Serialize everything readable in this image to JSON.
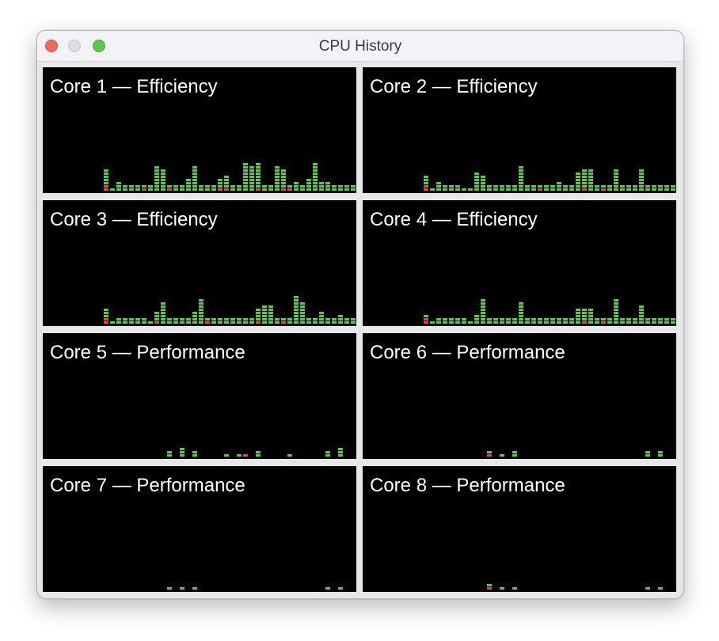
{
  "window": {
    "title": "CPU History",
    "buttons": [
      "close",
      "minimize",
      "zoom"
    ]
  },
  "colors": {
    "background": "#000000",
    "system": "#e8483c",
    "user": "#5cc94a",
    "traffic_close": "#ec6a5e",
    "traffic_min": "#dddde1",
    "traffic_zoom": "#61c554"
  },
  "cores": [
    {
      "label": "Core 1 — Efficiency",
      "system": [
        2,
        0,
        0,
        0,
        0,
        0,
        1,
        0,
        0,
        0,
        1,
        0,
        0,
        0,
        0,
        0,
        0,
        0,
        1,
        1,
        0,
        0,
        0,
        0,
        1,
        0,
        0,
        0,
        1,
        1,
        0,
        0,
        0,
        0,
        0,
        0,
        0,
        0
      ],
      "total": [
        7,
        1,
        3,
        2,
        2,
        2,
        2,
        2,
        8,
        7,
        2,
        2,
        2,
        4,
        8,
        2,
        2,
        2,
        4,
        5,
        2,
        2,
        9,
        8,
        9,
        2,
        2,
        8,
        7,
        2,
        3,
        2,
        4,
        9,
        3,
        3,
        2,
        2,
        2,
        2
      ]
    },
    {
      "label": "Core 2 — Efficiency",
      "system": [
        2,
        0,
        0,
        0,
        0,
        0,
        0,
        0,
        0,
        0,
        0,
        0,
        0,
        0,
        0,
        0,
        0,
        0,
        1,
        0,
        0,
        0,
        0,
        0,
        0,
        1,
        0,
        0,
        1,
        0,
        0,
        0,
        0,
        0,
        0,
        0,
        0,
        0
      ],
      "total": [
        5,
        1,
        3,
        2,
        2,
        2,
        1,
        1,
        6,
        5,
        2,
        2,
        2,
        2,
        2,
        8,
        2,
        2,
        2,
        2,
        2,
        3,
        2,
        2,
        6,
        7,
        7,
        2,
        2,
        2,
        7,
        2,
        2,
        2,
        7,
        2,
        2,
        2,
        2,
        2
      ]
    },
    {
      "label": "Core 3 — Efficiency",
      "system": [
        2,
        0,
        0,
        0,
        0,
        0,
        0,
        0,
        1,
        0,
        0,
        0,
        0,
        0,
        0,
        0,
        1,
        0,
        0,
        0,
        0,
        0,
        0,
        0,
        1,
        0,
        0,
        0,
        1,
        0,
        0,
        0,
        0,
        0,
        0,
        0,
        0,
        0
      ],
      "total": [
        5,
        1,
        2,
        2,
        2,
        2,
        2,
        1,
        4,
        7,
        2,
        2,
        2,
        2,
        4,
        8,
        2,
        2,
        2,
        2,
        2,
        2,
        2,
        2,
        5,
        6,
        6,
        2,
        2,
        2,
        9,
        7,
        2,
        2,
        4,
        2,
        2,
        3,
        2,
        2
      ]
    },
    {
      "label": "Core 4 — Efficiency",
      "system": [
        2,
        0,
        0,
        0,
        0,
        0,
        0,
        0,
        0,
        0,
        0,
        0,
        0,
        0,
        0,
        0,
        0,
        0,
        0,
        0,
        0,
        0,
        0,
        0,
        0,
        1,
        0,
        0,
        1,
        0,
        0,
        0,
        0,
        0,
        0,
        0,
        0,
        0
      ],
      "total": [
        3,
        1,
        2,
        2,
        2,
        2,
        2,
        1,
        3,
        8,
        2,
        2,
        2,
        2,
        2,
        7,
        2,
        2,
        2,
        2,
        2,
        2,
        2,
        2,
        5,
        5,
        5,
        2,
        2,
        2,
        8,
        2,
        2,
        2,
        6,
        2,
        2,
        2,
        2,
        2
      ]
    },
    {
      "label": "Core 5 — Performance",
      "system": [
        0,
        0,
        0,
        0,
        0,
        0,
        0,
        0,
        0,
        0,
        0,
        0,
        1,
        0,
        0,
        0,
        0,
        0,
        0,
        0,
        0,
        0,
        0,
        0,
        0,
        0,
        0,
        0,
        0,
        0
      ],
      "total": [
        2,
        0,
        3,
        0,
        2,
        0,
        0,
        0,
        0,
        1,
        0,
        1,
        1,
        0,
        2,
        0,
        0,
        0,
        0,
        1,
        0,
        0,
        0,
        0,
        0,
        2,
        0,
        3,
        0,
        0
      ]
    },
    {
      "label": "Core 6 — Performance",
      "system": [
        1,
        0,
        0,
        0,
        0,
        0,
        0,
        0,
        0,
        0,
        0,
        0,
        0,
        0,
        0,
        0,
        0,
        0,
        0,
        0,
        0,
        0,
        0,
        0,
        0,
        0,
        0,
        0,
        0,
        0
      ],
      "total": [
        2,
        0,
        1,
        0,
        2,
        0,
        0,
        0,
        0,
        0,
        0,
        0,
        0,
        0,
        0,
        0,
        0,
        0,
        0,
        0,
        0,
        0,
        0,
        0,
        0,
        2,
        0,
        2,
        0,
        0
      ]
    },
    {
      "label": "Core 7 — Performance",
      "system": [
        0,
        0,
        0,
        0,
        0,
        0,
        0,
        0,
        0,
        0,
        0,
        0,
        0,
        0,
        0,
        0,
        0,
        0,
        0,
        0,
        0,
        0,
        0,
        0,
        0,
        0,
        0,
        0,
        0,
        0
      ],
      "total": [
        1,
        0,
        1,
        0,
        1,
        0,
        0,
        0,
        0,
        0,
        0,
        0,
        0,
        0,
        0,
        0,
        0,
        0,
        0,
        0,
        0,
        0,
        0,
        0,
        0,
        1,
        0,
        1,
        0,
        0
      ]
    },
    {
      "label": "Core 8 — Performance",
      "system": [
        1,
        0,
        0,
        0,
        0,
        0,
        0,
        0,
        0,
        0,
        0,
        0,
        0,
        0,
        0,
        0,
        0,
        0,
        0,
        0,
        0,
        0,
        0,
        0,
        0,
        0,
        0,
        0,
        0,
        0
      ],
      "total": [
        2,
        0,
        1,
        0,
        1,
        0,
        0,
        0,
        0,
        0,
        0,
        0,
        0,
        0,
        0,
        0,
        0,
        0,
        0,
        0,
        0,
        0,
        0,
        0,
        0,
        1,
        0,
        1,
        0,
        0
      ]
    }
  ]
}
